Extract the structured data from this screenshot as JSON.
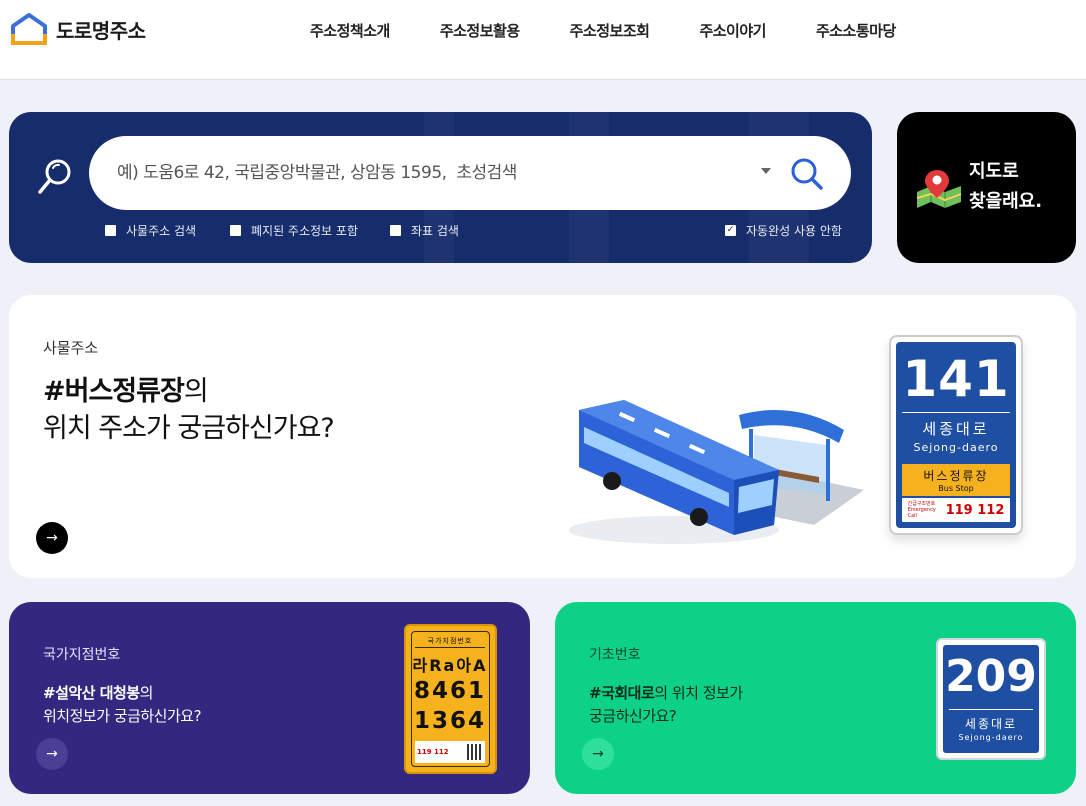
{
  "header": {
    "logo_text": "도로명주소",
    "nav": [
      "주소정책소개",
      "주소정보활용",
      "주소정보조회",
      "주소이야기",
      "주소소통마당"
    ]
  },
  "search": {
    "placeholder": "예) 도움6로 42, 국립중앙박물관, 상암동 1595,  초성검색",
    "options": [
      {
        "label": "사물주소 검색",
        "checked": false
      },
      {
        "label": "폐지된 주소정보 포함",
        "checked": false
      },
      {
        "label": "좌표 검색",
        "checked": false
      },
      {
        "label": "자동완성 사용 안함",
        "checked": true
      }
    ]
  },
  "map_card": {
    "line1": "지도로",
    "line2": "찾을래요."
  },
  "banner": {
    "category": "사물주소",
    "title_strong": "#버스정류장",
    "title_rest": "의",
    "title_line2": "위치 주소가 궁금하신가요?",
    "arrow": "→",
    "sign": {
      "number": "141",
      "road_ko": "세종대로",
      "road_en": "Sejong-daero",
      "stop_ko": "버스정류장",
      "stop_en": "Bus Stop",
      "emergency_label": "긴급구조번호 Emergency Call",
      "emergency_nums": "119 112"
    }
  },
  "cards": {
    "national": {
      "category": "국가지점번호",
      "title_strong": "#설악산 대청봉",
      "title_rest": "의",
      "title_line2": "위치정보가 궁금하신가요?",
      "arrow": "→",
      "plate": {
        "title": "국가지점번호",
        "grid": "라Ra아A",
        "num1": "8461",
        "num2": "1364",
        "foot": "119 112"
      }
    },
    "base": {
      "category": "기초번호",
      "title_strong": "#국회대로",
      "title_rest": "의 위치 정보가",
      "title_line2": "궁금하신가요?",
      "arrow": "→",
      "sign": {
        "number": "209",
        "road_ko": "세종대로",
        "road_en": "Sejong-daero"
      }
    }
  },
  "colors": {
    "search_bg": "#162c6b",
    "map_card_bg": "#000000",
    "purple_card": "#33287f",
    "green_card": "#0dd185",
    "sign_blue": "#1f4fa3",
    "sign_yellow": "#f5b21d",
    "logo_blue": "#3a6fd8",
    "logo_orange": "#f5a21b"
  },
  "icons": [
    "home-logo-icon",
    "magnifier-deco-icon",
    "search-icon",
    "map-pin-icon",
    "arrow-right-icon"
  ]
}
